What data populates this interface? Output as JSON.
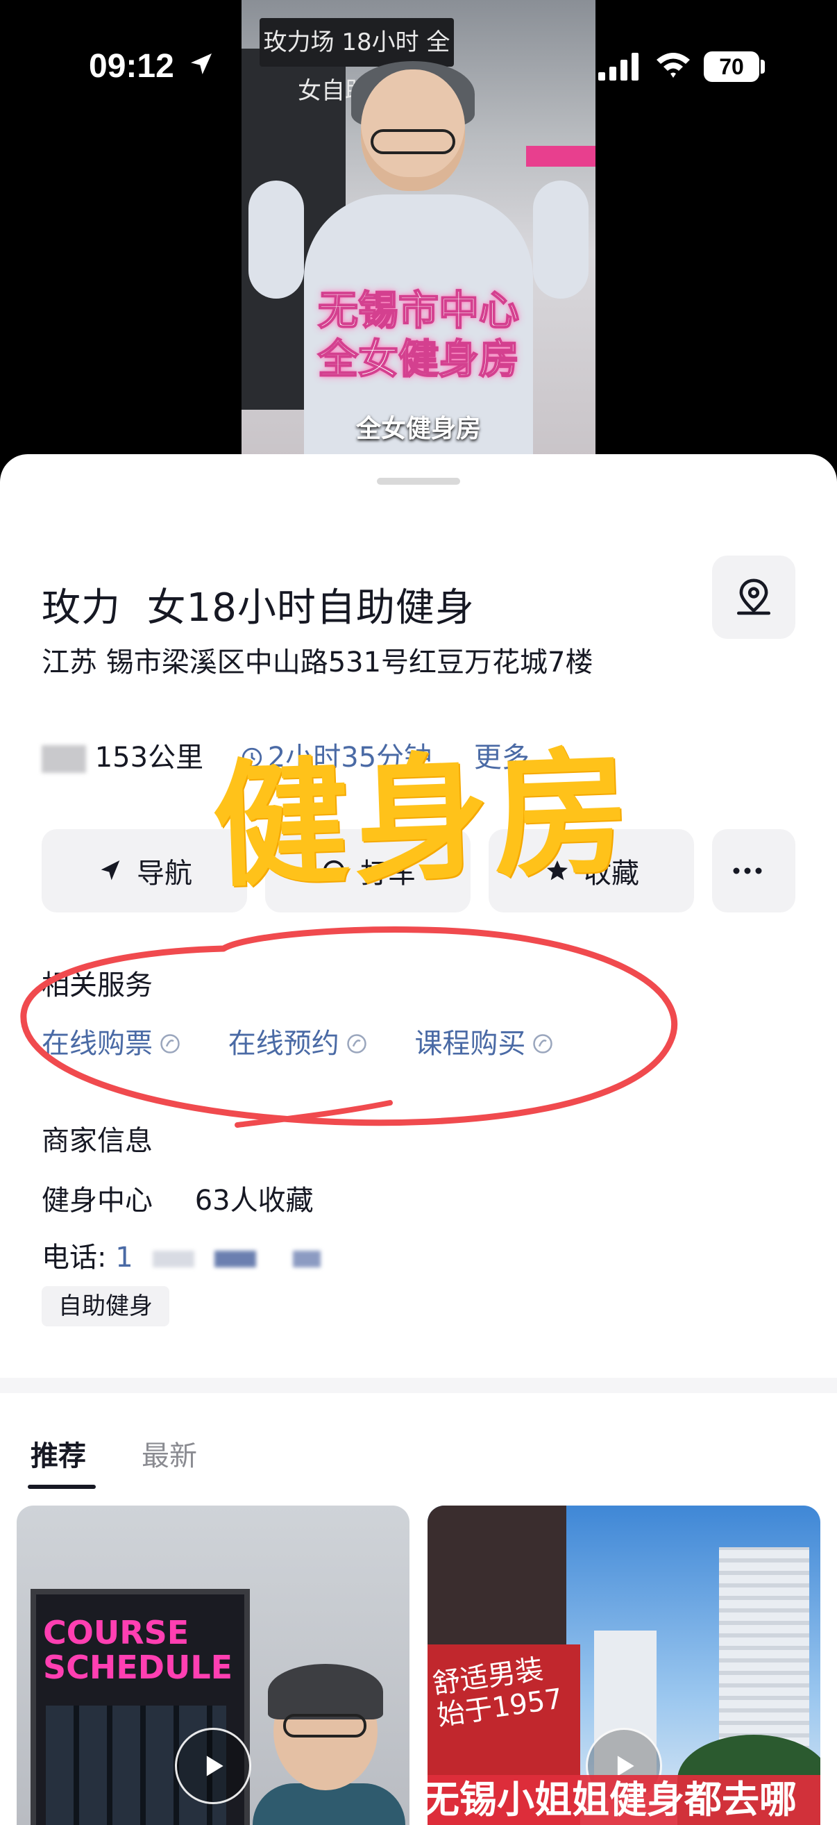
{
  "status_bar": {
    "time": "09:12",
    "battery": "70"
  },
  "video": {
    "sign_text": "玫力场 18小时 全女自助健身",
    "caption_line1": "无锡市中心",
    "caption_line2": "全女健身房",
    "subtitle": "全女健身房"
  },
  "poi": {
    "title": "玫力‍‍  ‍ 女18小时自助健身",
    "address": "江苏      锡市梁溪区中山路531号红豆万花城7楼",
    "distance": "153公里",
    "hours": "2小时35分钟",
    "more": "更多"
  },
  "actions": {
    "navigate": "导航",
    "taxi": "打车",
    "favorite": "收藏"
  },
  "overlay": {
    "big_text": "健身房",
    "color": "#ffc21a"
  },
  "services": {
    "label": "相关服务",
    "items": [
      "在线购票",
      "在线预约",
      "课程购买"
    ]
  },
  "merchant": {
    "label": "商家信息",
    "category": "健身中心",
    "favorites": "63人收藏",
    "phone_label": "电话:",
    "phone_partial": "1",
    "tag": "自助健身"
  },
  "feed": {
    "tabs": [
      "推荐",
      "最新"
    ],
    "active_tab": "推荐",
    "cards": [
      {
        "board_text": "COURSE SCHEDULE"
      },
      {
        "sign_text": "舒适男装 始于1957",
        "banner": "无锡小姐姐健身都去哪"
      }
    ]
  },
  "colors": {
    "link": "#4a6aa5",
    "annotation_red": "#f04a4e",
    "text": "#161823"
  }
}
